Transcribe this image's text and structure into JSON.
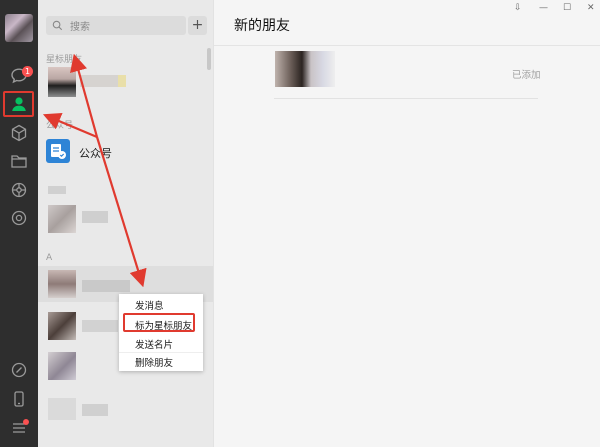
{
  "rail": {
    "chat_badge": "1",
    "icons": [
      "chat-icon",
      "contacts-icon",
      "cube-icon",
      "folder-icon",
      "mini-program-icon",
      "aperture-icon",
      "link-icon",
      "phone-icon",
      "menu-icon"
    ]
  },
  "list": {
    "search_placeholder": "搜索",
    "add_label": "+",
    "section_starred": "星标朋友",
    "section_official": "公众号",
    "official_account_label": "公众号",
    "section_a": "A"
  },
  "context_menu": {
    "items": [
      "发消息",
      "标为星标朋友",
      "发送名片",
      "删除朋友"
    ]
  },
  "main": {
    "title": "新的朋友",
    "request_status": "已添加",
    "window_controls": [
      "⇩",
      "—",
      "☐",
      "✕"
    ]
  },
  "colors": {
    "rail_bg": "#2e2e2e",
    "list_bg": "#e9e9e9",
    "annotation_red": "#e03a2f",
    "badge_red": "#fa5151",
    "active_green": "#07c160"
  }
}
